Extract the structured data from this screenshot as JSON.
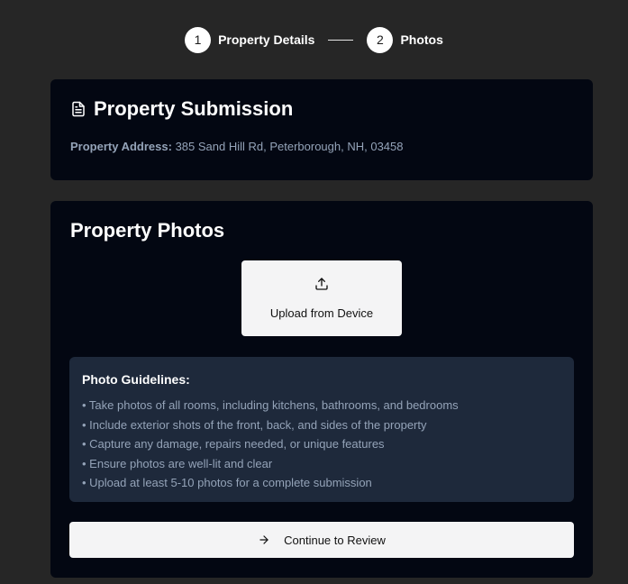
{
  "stepper": {
    "steps": [
      {
        "number": "1",
        "label": "Property Details"
      },
      {
        "number": "2",
        "label": "Photos"
      }
    ]
  },
  "submission": {
    "title": "Property Submission",
    "address_label": "Property Address:",
    "address_value": "385 Sand Hill Rd, Peterborough, NH, 03458"
  },
  "photos": {
    "title": "Property Photos",
    "upload_label": "Upload from Device",
    "guidelines": {
      "title": "Photo Guidelines:",
      "items": [
        "• Take photos of all rooms, including kitchens, bathrooms, and bedrooms",
        "• Include exterior shots of the front, back, and sides of the property",
        "• Capture any damage, repairs needed, or unique features",
        "• Ensure photos are well-lit and clear",
        "• Upload at least 5-10 photos for a complete submission"
      ]
    },
    "continue_label": "Continue to Review"
  },
  "icons": {
    "document": "document-icon",
    "upload": "upload-icon",
    "arrow": "arrow-right-icon"
  },
  "colors": {
    "page_background": "#262626",
    "card_background": "#030712",
    "guidelines_background": "#1e293b",
    "muted_text": "#94a3b8",
    "button_background": "#f4f4f5"
  }
}
